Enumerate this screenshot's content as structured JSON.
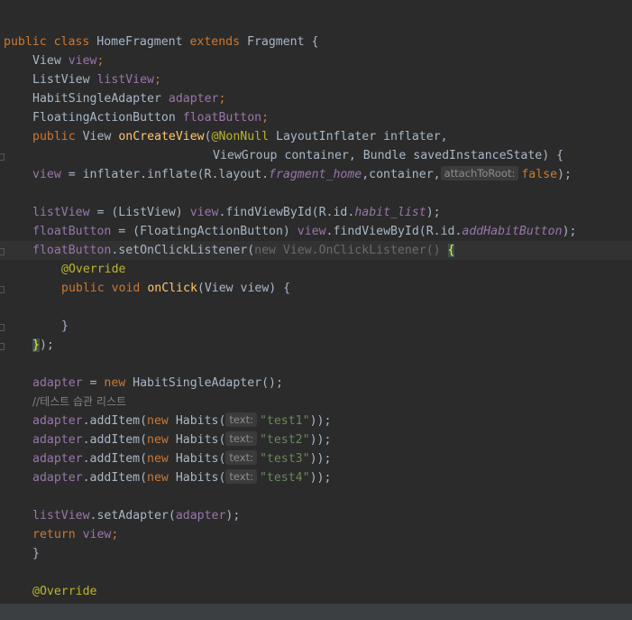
{
  "code": {
    "class_decl": {
      "kw1": "public",
      "kw2": "class",
      "name": "HomeFragment",
      "kw3": "extends",
      "parent": "Fragment",
      "brace": " {"
    },
    "field1": {
      "type": "View",
      "name": "view"
    },
    "field2": {
      "type": "ListView",
      "name": "listView"
    },
    "field3": {
      "type": "HabitSingleAdapter",
      "name": "adapter"
    },
    "field4": {
      "type": "FloatingActionButton",
      "name": "floatButton"
    },
    "method_decl": {
      "kw": "public",
      "ret": "View",
      "name": "onCreateView",
      "ann": "@NonNull",
      "params1": " LayoutInflater inflater,",
      "params2": "ViewGroup container, Bundle savedInstanceState) {"
    },
    "inflate": {
      "lhs": "view",
      "mid": " = inflater.inflate(R.layout.",
      "res": "fragment_home",
      "args": ",container,",
      "hint": "attachToRoot:",
      "val": "false"
    },
    "listview_find": {
      "lhs": "listView",
      "mid": " = (ListView) ",
      "obj": "view",
      "call": ".findViewById(R.id.",
      "res": "habit_list"
    },
    "float_find": {
      "lhs": "floatButton",
      "mid": " = (FloatingActionButton) ",
      "obj": "view",
      "call": ".findViewById(R.id.",
      "res": "addHabitButton"
    },
    "set_listener": {
      "lhs": "floatButton",
      "call": ".setOnClickListener(",
      "anon": "new View.OnClickListener() ",
      "brace": "{"
    },
    "override1": "@Override",
    "onclick": {
      "kw1": "public",
      "kw2": "void",
      "name": "onClick",
      "rest": "(View view) {"
    },
    "close_inner": "}",
    "close_listener": {
      "brace": "}",
      "rest": ");"
    },
    "adapter_new": {
      "lhs": "adapter",
      "mid": " = ",
      "kw": "new",
      "rest": " HabitSingleAdapter();"
    },
    "comment": "//테스트 습관 리스트",
    "add_items": [
      {
        "obj": "adapter",
        "call": ".addItem(",
        "kw": "new",
        "cls": " Habits(",
        "hint": "text:",
        "str": "\"test1\"",
        "end": "));"
      },
      {
        "obj": "adapter",
        "call": ".addItem(",
        "kw": "new",
        "cls": " Habits(",
        "hint": "text:",
        "str": "\"test2\"",
        "end": "));"
      },
      {
        "obj": "adapter",
        "call": ".addItem(",
        "kw": "new",
        "cls": " Habits(",
        "hint": "text:",
        "str": "\"test3\"",
        "end": "));"
      },
      {
        "obj": "adapter",
        "call": ".addItem(",
        "kw": "new",
        "cls": " Habits(",
        "hint": "text:",
        "str": "\"test4\"",
        "end": "));"
      }
    ],
    "set_adapter": {
      "obj": "listView",
      "call": ".setAdapter(",
      "arg": "adapter",
      "end": ");"
    },
    "return_stmt": {
      "kw": "return",
      "val": "view"
    },
    "close_method": "}",
    "override2": "@Override"
  }
}
